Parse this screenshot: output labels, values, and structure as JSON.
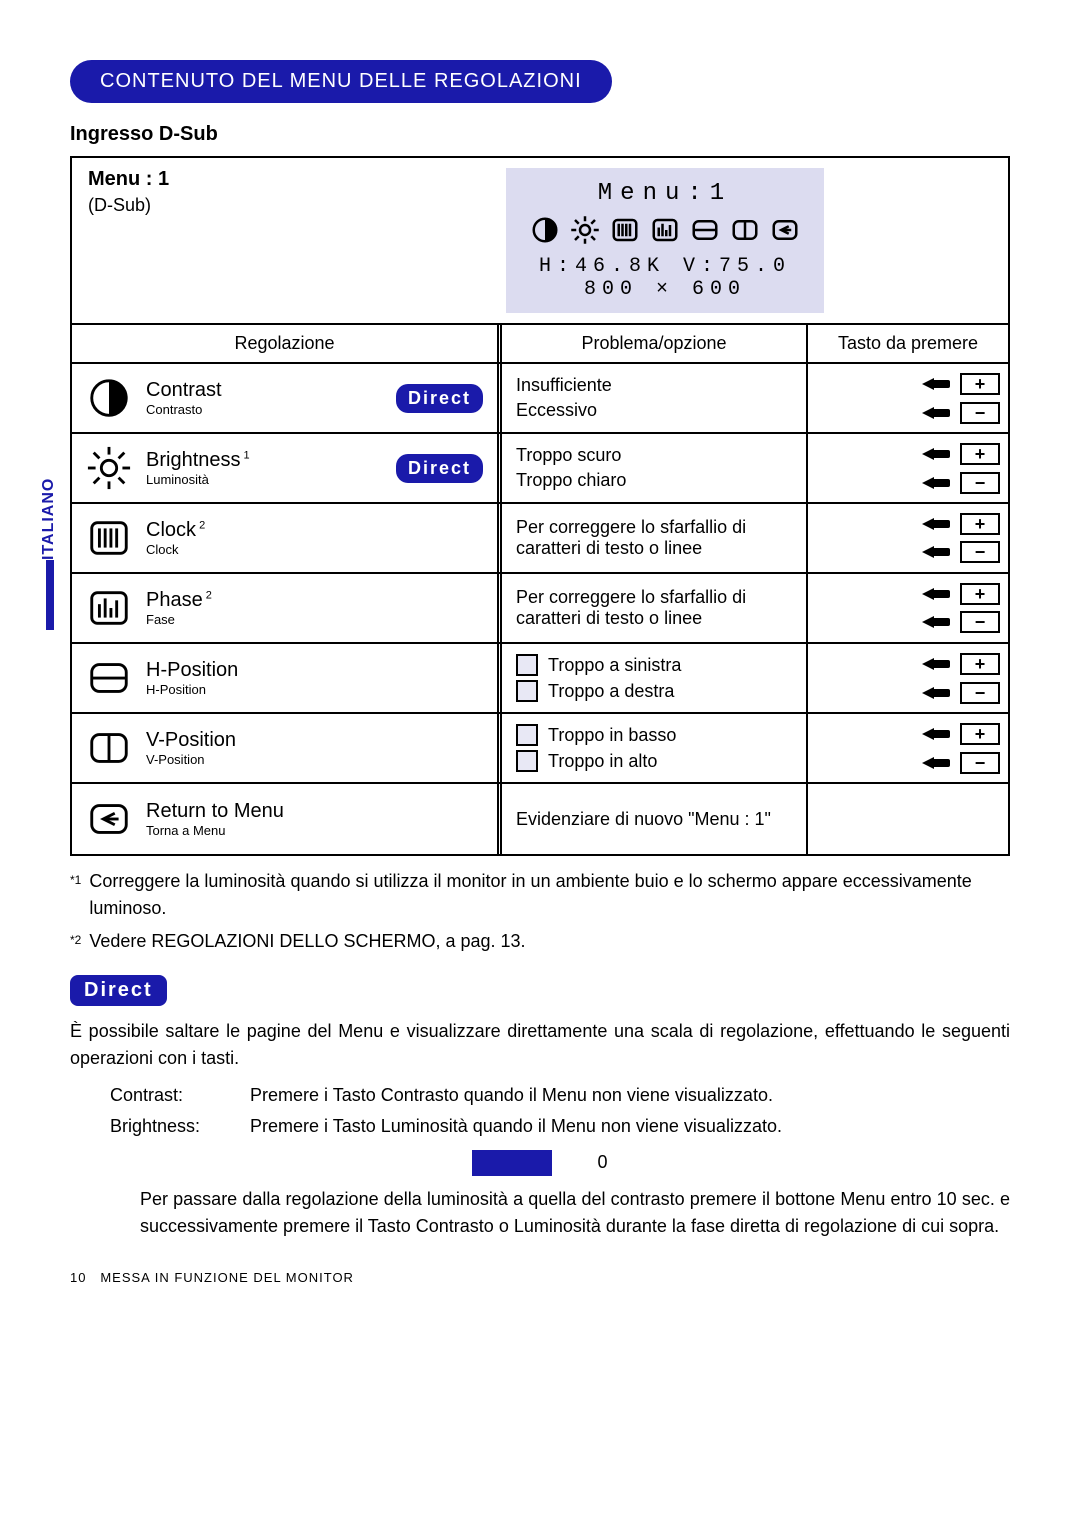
{
  "side_tab": "ITALIANO",
  "title_pill": "CONTENUTO DEL MENU DELLE REGOLAZIONI",
  "h2": "Ingresso D-Sub",
  "top_left": {
    "menu": "Menu : 1",
    "sub": "(D-Sub)"
  },
  "osd": {
    "title": "Menu:1",
    "line1": "H:46.8K V:75.0",
    "line2": "800 × 600"
  },
  "headers": {
    "reg": "Regolazione",
    "prob": "Problema/opzione",
    "key": "Tasto da premere"
  },
  "direct_label": "Direct",
  "rows": [
    {
      "icon": "contrast",
      "name": "Contrast",
      "sub": "Contrasto",
      "direct": true,
      "problems": [
        "Insufficiente",
        "Eccessivo"
      ],
      "keys": [
        "plus",
        "minus"
      ]
    },
    {
      "icon": "brightness",
      "name": "Brightness",
      "sup": "1",
      "sub": "Luminosità",
      "direct": true,
      "problems": [
        "Troppo scuro",
        "Troppo chiaro"
      ],
      "keys": [
        "plus",
        "minus"
      ]
    },
    {
      "icon": "clock",
      "name": "Clock",
      "sup": "2",
      "sub": "Clock",
      "problems_single": "Per correggere lo sfarfallio di caratteri di testo o linee",
      "keys": [
        "plus",
        "minus"
      ],
      "keys_center": true
    },
    {
      "icon": "phase",
      "name": "Phase",
      "sup": "2",
      "sub": "Fase",
      "problems_single": "Per correggere lo sfarfallio di caratteri di testo o linee",
      "keys": [
        "plus",
        "minus"
      ],
      "keys_center": true
    },
    {
      "icon": "hpos",
      "name": "H-Position",
      "sub": "H-Position",
      "problems_icon": [
        {
          "t": "Troppo a sinistra"
        },
        {
          "t": "Troppo a destra"
        }
      ],
      "keys": [
        "plus",
        "minus"
      ]
    },
    {
      "icon": "vpos",
      "name": "V-Position",
      "sub": "V-Position",
      "problems_icon": [
        {
          "t": "Troppo in basso"
        },
        {
          "t": "Troppo in alto"
        }
      ],
      "keys": [
        "plus",
        "minus"
      ]
    },
    {
      "icon": "return",
      "name": "Return to Menu",
      "sub": "Torna a Menu",
      "problems_single": "Evidenziare di nuovo \"Menu : 1\"",
      "no_keys": true
    }
  ],
  "footnotes": {
    "f1": "Correggere la luminosità quando si utilizza il monitor in un ambiente buio e lo schermo appare eccessivamente luminoso.",
    "f2": "Vedere REGOLAZIONI DELLO SCHERMO, a pag. 13."
  },
  "direct_section": {
    "title": "Direct",
    "intro": "È possibile saltare le pagine del Menu e visualizzare direttamente una scala di regolazione, effettuando le seguenti operazioni con i tasti.",
    "items": [
      {
        "k": "Contrast:",
        "v": "Premere i Tasto Contrasto quando il Menu non viene visualizzato."
      },
      {
        "k": "Brightness:",
        "v": "Premere i Tasto Luminosità quando il Menu non viene visualizzato."
      }
    ],
    "zero": "0",
    "para2": "Per passare dalla regolazione della luminosità a quella del contrasto premere il bottone Menu entro 10 sec. e successivamente premere il Tasto Contrasto o Luminosità durante la fase diretta di regolazione di cui sopra."
  },
  "page_footer": {
    "num": "10",
    "label": "MESSA IN FUNZIONE DEL MONITOR"
  }
}
